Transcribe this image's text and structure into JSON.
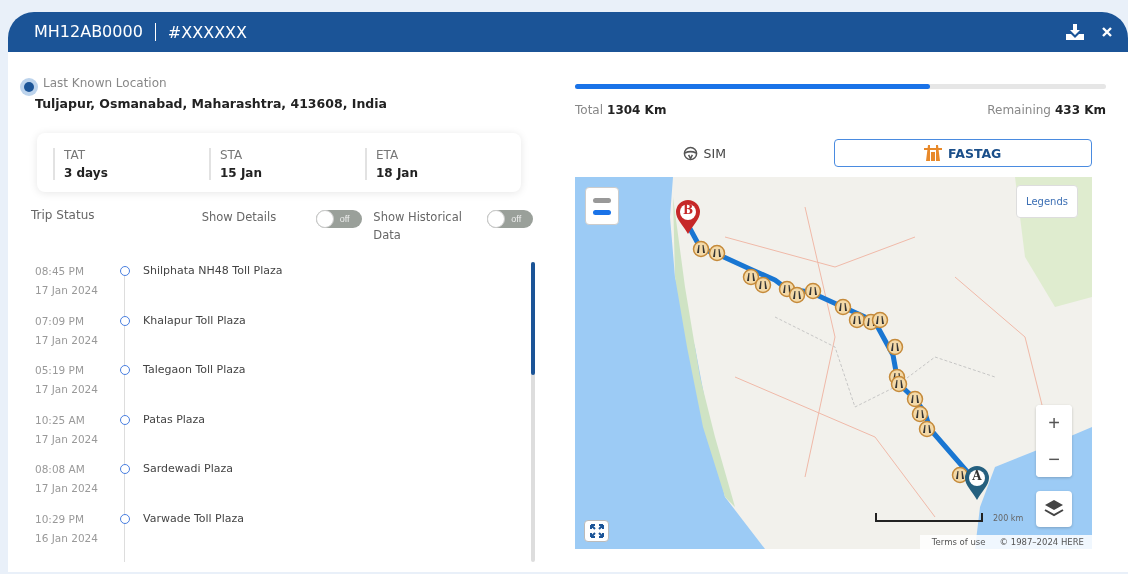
{
  "header": {
    "vehicle": "MH12AB0000",
    "trip_id": "#XXXXXX"
  },
  "last_location": {
    "label": "Last Known Location",
    "address": "Tuljapur, Osmanabad, Maharashtra, 413608, India"
  },
  "stats": [
    {
      "label": "TAT",
      "value": "3 days"
    },
    {
      "label": "STA",
      "value": "15 Jan"
    },
    {
      "label": "ETA",
      "value": "18 Jan"
    }
  ],
  "trip_status": {
    "title": "Trip Status"
  },
  "toggles": [
    {
      "label": "Show Details",
      "on": false,
      "text": "off"
    },
    {
      "label": "Show Historical Data",
      "on": false,
      "text": "off"
    }
  ],
  "timeline": [
    {
      "time": "08:45 PM",
      "date": "17 Jan 2024",
      "place": "Shilphata NH48 Toll Plaza"
    },
    {
      "time": "07:09 PM",
      "date": "17 Jan 2024",
      "place": "Khalapur Toll Plaza"
    },
    {
      "time": "05:19 PM",
      "date": "17 Jan 2024",
      "place": "Talegaon Toll Plaza"
    },
    {
      "time": "10:25 AM",
      "date": "17 Jan 2024",
      "place": "Patas Plaza"
    },
    {
      "time": "08:08 AM",
      "date": "17 Jan 2024",
      "place": "Sardewadi Plaza"
    },
    {
      "time": "10:29 PM",
      "date": "16 Jan 2024",
      "place": "Varwade Toll Plaza"
    }
  ],
  "progress": {
    "level": 0.668,
    "total_label": "Total",
    "total": "1304 Km",
    "remaining_label": "Remaining",
    "remaining": "433 Km"
  },
  "source_tabs": [
    {
      "label": "SIM",
      "kind": "sim",
      "selected": false
    },
    {
      "label": "FASTAG",
      "kind": "fastag",
      "selected": true
    }
  ],
  "map": {
    "legends": "Legends",
    "zoom_in": "+",
    "zoom_out": "−",
    "scale": "200 km",
    "terms": "Terms of use",
    "copyright": "© 1987–2024 HERE",
    "start_marker": "A",
    "end_marker": "B"
  }
}
